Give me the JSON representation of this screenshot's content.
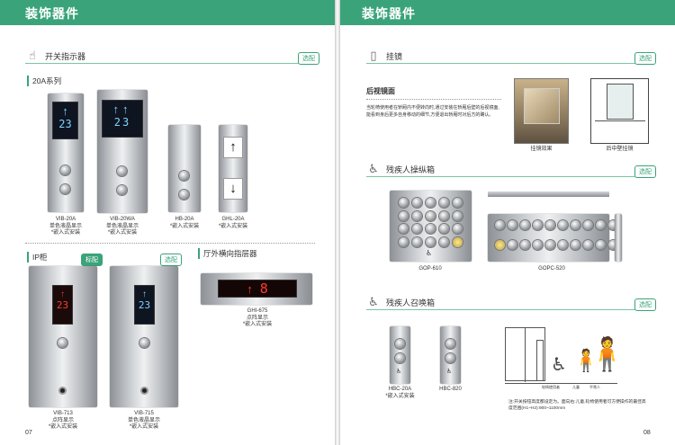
{
  "left": {
    "title": "装饰器件",
    "section_switch": "开关指示器",
    "tag_optional": "选配",
    "tag_standard": "标配",
    "series_20a": "20A系列",
    "ip_label": "IP柜",
    "hall_label": "厅外横向指层器",
    "page": "07",
    "products": [
      {
        "model": "VIB-20A",
        "desc1": "单色液晶显示",
        "desc2": "*嵌入式安装",
        "display": "23"
      },
      {
        "model": "VIB-20WA",
        "desc1": "单色液晶显示",
        "desc2": "*嵌入式安装",
        "display": "23"
      },
      {
        "model": "HB-20A",
        "desc1": "*嵌入式安装"
      },
      {
        "model": "GHL-20A",
        "desc1": "*嵌入式安装"
      },
      {
        "model": "VIB-713",
        "desc1": "点阵显示",
        "desc2": "*嵌入式安装",
        "display": "23"
      },
      {
        "model": "VIB-715",
        "desc1": "单色液晶显示",
        "desc2": "*嵌入式安装",
        "display": "23"
      },
      {
        "model": "GHI-675",
        "desc1": "点阵显示",
        "desc2": "*嵌入式安装",
        "display": "8"
      }
    ]
  },
  "right": {
    "title": "装饰器件",
    "section_mirror": "挂镜",
    "mirror_sub": "后视镜面",
    "mirror_text": "当轮椅使用者在轿厢内不便转向时,通过安装在轿厢后壁的后视镜面,能看到身后更多自身移动的细节,方便退出轿厢时对后方的确认。",
    "mirror_effect": "挂镜效果",
    "mirror_install": "后中壁挂镜",
    "section_disabled_cop": "残疾人操纵箱",
    "gop610": "GOP-610",
    "gopc520": "GOPC-520",
    "section_disabled_call": "残疾人召唤箱",
    "hbc20a": "HBC-20A",
    "hbc20a_desc": "*嵌入式安装",
    "hbc820": "HBC-820",
    "note": "注:开关按钮高度都设定为。面向右:儿童,轮椅使用者可方便操作的最佳高度范围(H1~H2):900~1100mm",
    "fig_wheelchair": "轮椅使用者",
    "fig_child": "儿童",
    "fig_adult": "平常人",
    "tag_optional": "选配",
    "page": "08"
  }
}
